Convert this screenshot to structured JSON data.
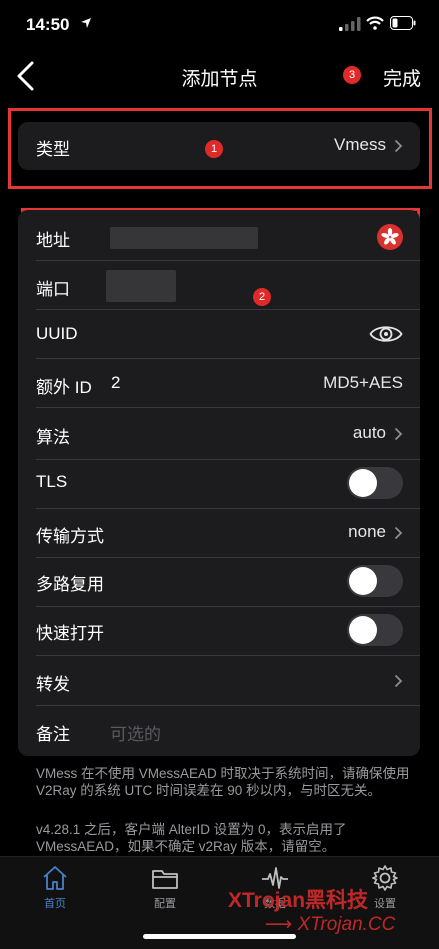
{
  "status": {
    "time": "14:50"
  },
  "nav": {
    "title": "添加节点",
    "done": "完成"
  },
  "badges": {
    "b1": "1",
    "b2": "2",
    "b3": "3"
  },
  "type_row": {
    "label": "类型",
    "value": "Vmess"
  },
  "server": {
    "address_label": "地址",
    "port_label": "端口",
    "uuid_label": "UUID",
    "extra_id_label": "额外 ID",
    "extra_id_value": "2",
    "security_value": "MD5+AES"
  },
  "settings": {
    "algorithm_label": "算法",
    "algorithm_value": "auto",
    "tls_label": "TLS",
    "transport_label": "传输方式",
    "transport_value": "none",
    "mux_label": "多路复用",
    "fastopen_label": "快速打开",
    "forward_label": "转发",
    "remark_label": "备注",
    "remark_placeholder": "可选的"
  },
  "toggles": {
    "tls": false,
    "mux": false,
    "fastopen": false
  },
  "notes": {
    "line1": "VMess 在不使用 VMessAEAD 时取决于系统时间，请确保使用 V2Ray 的系统 UTC 时间误差在 90 秒以内，与时区无关。",
    "line2": "v4.28.1 之后，客户端 AlterID 设置为 0，表示启用了 VMessAEAD，如果不确定 v2Ray 版本，请留空。"
  },
  "tabs": [
    {
      "label": "首页",
      "icon": "home-icon"
    },
    {
      "label": "配置",
      "icon": "folder-icon"
    },
    {
      "label": "数据",
      "icon": "waveform-icon"
    },
    {
      "label": "设置",
      "icon": "gear-icon"
    }
  ],
  "watermark": {
    "text1": "XTrojan黑科技",
    "text2": "XTrojan.CC"
  },
  "colors": {
    "accent_red": "#e53535",
    "tab_active": "#4a80c8",
    "card_bg": "#1c1c1e"
  }
}
